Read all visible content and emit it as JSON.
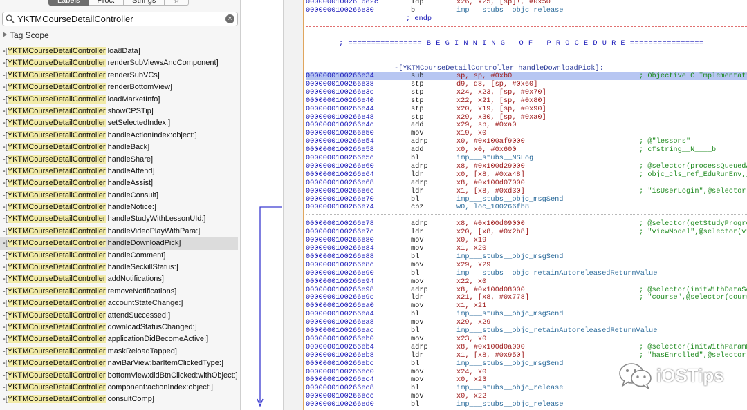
{
  "sidebar": {
    "tabs": [
      {
        "label": "Labels",
        "active": true
      },
      {
        "label": "Proc.",
        "active": false
      },
      {
        "label": "Strings",
        "active": false
      },
      {
        "label": "☆",
        "active": false
      }
    ],
    "search": {
      "value": "YKTMCourseDetailController",
      "placeholder": ""
    },
    "tag_scope": "Tag Scope",
    "class_prefix": "YKTMCourseDetailController",
    "methods": [
      {
        "name": "loadData]"
      },
      {
        "name": "renderSubViewsAndComponent]"
      },
      {
        "name": "renderSubVCs]"
      },
      {
        "name": "renderBottomView]"
      },
      {
        "name": "loadMarketInfo]"
      },
      {
        "name": "showCPSTip]"
      },
      {
        "name": "setSelectedIndex:]"
      },
      {
        "name": "handleActionIndex:object:]"
      },
      {
        "name": "handleBack]"
      },
      {
        "name": "handleShare]"
      },
      {
        "name": "handleAttend]"
      },
      {
        "name": "handleAssist]"
      },
      {
        "name": "handleConsult]"
      },
      {
        "name": "handleNotice:]"
      },
      {
        "name": "handleStudyWithLessonUId:]"
      },
      {
        "name": "handleVideoPlayWithPara:]"
      },
      {
        "name": "handleDownloadPick]",
        "selected": true
      },
      {
        "name": "handleComment]"
      },
      {
        "name": "handleSeckillStatus:]"
      },
      {
        "name": "addNotifications]"
      },
      {
        "name": "removeNotifications]"
      },
      {
        "name": "accountStateChange:]"
      },
      {
        "name": "attendSuccessed:]"
      },
      {
        "name": "downloadStatusChanged:]"
      },
      {
        "name": "applicationDidBecomeActive:]"
      },
      {
        "name": "maskReloadTapped]"
      },
      {
        "name": "naviBarView:barItemClickedType:]"
      },
      {
        "name": "bottomView:didBtnClicked:withObject:]"
      },
      {
        "name": "component:actionIndex:object:]"
      },
      {
        "name": "consultComp]"
      }
    ]
  },
  "code": {
    "header_lines": [
      {
        "addr": "000000010026 6e2c",
        "mnemonic": "ldp",
        "operands": "x26, x25, [sp]!, #0x50",
        "comment": ""
      },
      {
        "addr": "0000000100266e30",
        "mnemonic": "b",
        "operands": "imp___stubs__objc_release",
        "comment": "",
        "link": true
      }
    ],
    "endp": "; endp",
    "banner": "; ================ B E G I N N I N G   O F   P R O C E D U R E ================",
    "proc_name": "-[YKTMCourseDetailController handleDownloadPick]:",
    "lines": [
      {
        "addr": "0000000100266e34",
        "mnemonic": "sub",
        "operands": "sp, sp, #0xb0",
        "comment": "; Objective C Implementation",
        "selected": true
      },
      {
        "addr": "0000000100266e38",
        "mnemonic": "stp",
        "operands": "d9, d8, [sp, #0x60]",
        "comment": ""
      },
      {
        "addr": "0000000100266e3c",
        "mnemonic": "stp",
        "operands": "x24, x23, [sp, #0x70]",
        "comment": ""
      },
      {
        "addr": "0000000100266e40",
        "mnemonic": "stp",
        "operands": "x22, x21, [sp, #0x80]",
        "comment": ""
      },
      {
        "addr": "0000000100266e44",
        "mnemonic": "stp",
        "operands": "x20, x19, [sp, #0x90]",
        "comment": ""
      },
      {
        "addr": "0000000100266e48",
        "mnemonic": "stp",
        "operands": "x29, x30, [sp, #0xa0]",
        "comment": ""
      },
      {
        "addr": "0000000100266e4c",
        "mnemonic": "add",
        "operands": "x29, sp, #0xa0",
        "comment": ""
      },
      {
        "addr": "0000000100266e50",
        "mnemonic": "mov",
        "operands": "x19, x0",
        "comment": ""
      },
      {
        "addr": "0000000100266e54",
        "mnemonic": "adrp",
        "operands": "x0, #0x100af9000",
        "comment": "; @\"lessons\""
      },
      {
        "addr": "0000000100266e58",
        "mnemonic": "add",
        "operands": "x0, x0, #0x600",
        "comment": "; cfstring__N____b"
      },
      {
        "addr": "0000000100266e5c",
        "mnemonic": "bl",
        "operands": "imp___stubs__NSLog",
        "comment": "",
        "link": true
      },
      {
        "addr": "0000000100266e60",
        "mnemonic": "adrp",
        "operands": "x8, #0x100d29000",
        "comment": "; @selector(processQueuedAm"
      },
      {
        "addr": "0000000100266e64",
        "mnemonic": "ldr",
        "operands": "x0, [x8, #0xa48]",
        "comment": "; objc_cls_ref_EduRunEnv,_OB"
      },
      {
        "addr": "0000000100266e68",
        "mnemonic": "adrp",
        "operands": "x8, #0x100d07000",
        "comment": ""
      },
      {
        "addr": "0000000100266e6c",
        "mnemonic": "ldr",
        "operands": "x1, [x8, #0xd30]",
        "comment": "; \"isUserLogin\",@selector(is"
      },
      {
        "addr": "0000000100266e70",
        "mnemonic": "bl",
        "operands": "imp___stubs__objc_msgSend",
        "comment": "",
        "link": true
      },
      {
        "addr": "0000000100266e74",
        "mnemonic": "cbz",
        "operands": "w0, loc_100266fb8",
        "comment": "",
        "link": true
      },
      {
        "addr": "0000000100266e78",
        "mnemonic": "adrp",
        "operands": "x8, #0x100d09000",
        "comment": "; @selector(getStudyProgre"
      },
      {
        "addr": "0000000100266e7c",
        "mnemonic": "ldr",
        "operands": "x20, [x8, #0x2b8]",
        "comment": "; \"viewModel\",@selector(vie"
      },
      {
        "addr": "0000000100266e80",
        "mnemonic": "mov",
        "operands": "x0, x19",
        "comment": ""
      },
      {
        "addr": "0000000100266e84",
        "mnemonic": "mov",
        "operands": "x1, x20",
        "comment": ""
      },
      {
        "addr": "0000000100266e88",
        "mnemonic": "bl",
        "operands": "imp___stubs__objc_msgSend",
        "comment": "",
        "link": true
      },
      {
        "addr": "0000000100266e8c",
        "mnemonic": "mov",
        "operands": "x29, x29",
        "comment": ""
      },
      {
        "addr": "0000000100266e90",
        "mnemonic": "bl",
        "operands": "imp___stubs__objc_retainAutoreleasedReturnValue",
        "comment": "",
        "link": true
      },
      {
        "addr": "0000000100266e94",
        "mnemonic": "mov",
        "operands": "x22, x0",
        "comment": ""
      },
      {
        "addr": "0000000100266e98",
        "mnemonic": "adrp",
        "operands": "x8, #0x100d08000",
        "comment": "; @selector(initWithDataSo"
      },
      {
        "addr": "0000000100266e9c",
        "mnemonic": "ldr",
        "operands": "x21, [x8, #0x778]",
        "comment": "; \"course\",@selector(course"
      },
      {
        "addr": "0000000100266ea0",
        "mnemonic": "mov",
        "operands": "x1, x21",
        "comment": ""
      },
      {
        "addr": "0000000100266ea4",
        "mnemonic": "bl",
        "operands": "imp___stubs__objc_msgSend",
        "comment": "",
        "link": true
      },
      {
        "addr": "0000000100266ea8",
        "mnemonic": "mov",
        "operands": "x29, x29",
        "comment": ""
      },
      {
        "addr": "0000000100266eac",
        "mnemonic": "bl",
        "operands": "imp___stubs__objc_retainAutoreleasedReturnValue",
        "comment": "",
        "link": true
      },
      {
        "addr": "0000000100266eb0",
        "mnemonic": "mov",
        "operands": "x23, x0",
        "comment": ""
      },
      {
        "addr": "0000000100266eb4",
        "mnemonic": "adrp",
        "operands": "x8, #0x100d0a000",
        "comment": "; @selector(initWithParamD"
      },
      {
        "addr": "0000000100266eb8",
        "mnemonic": "ldr",
        "operands": "x1, [x8, #0x950]",
        "comment": "; \"hasEnrolled\",@selector(h"
      },
      {
        "addr": "0000000100266ebc",
        "mnemonic": "bl",
        "operands": "imp___stubs__objc_msgSend",
        "comment": "",
        "link": true
      },
      {
        "addr": "0000000100266ec0",
        "mnemonic": "mov",
        "operands": "x24, x0",
        "comment": ""
      },
      {
        "addr": "0000000100266ec4",
        "mnemonic": "mov",
        "operands": "x0, x23",
        "comment": ""
      },
      {
        "addr": "0000000100266ec8",
        "mnemonic": "bl",
        "operands": "imp___stubs__objc_release",
        "comment": "",
        "link": true
      },
      {
        "addr": "0000000100266ecc",
        "mnemonic": "mov",
        "operands": "x0, x22",
        "comment": ""
      },
      {
        "addr": "0000000100266ed0",
        "mnemonic": "bl",
        "operands": "imp___stubs__objc_release",
        "comment": "",
        "link": true
      }
    ]
  },
  "watermark": {
    "text": "iOSTips",
    "icon": "wechat-icon"
  },
  "colors": {
    "selection": "#b7c6f2",
    "highlight": "#f2eba7",
    "address": "#1818b8",
    "comment": "#1f8a1f"
  }
}
